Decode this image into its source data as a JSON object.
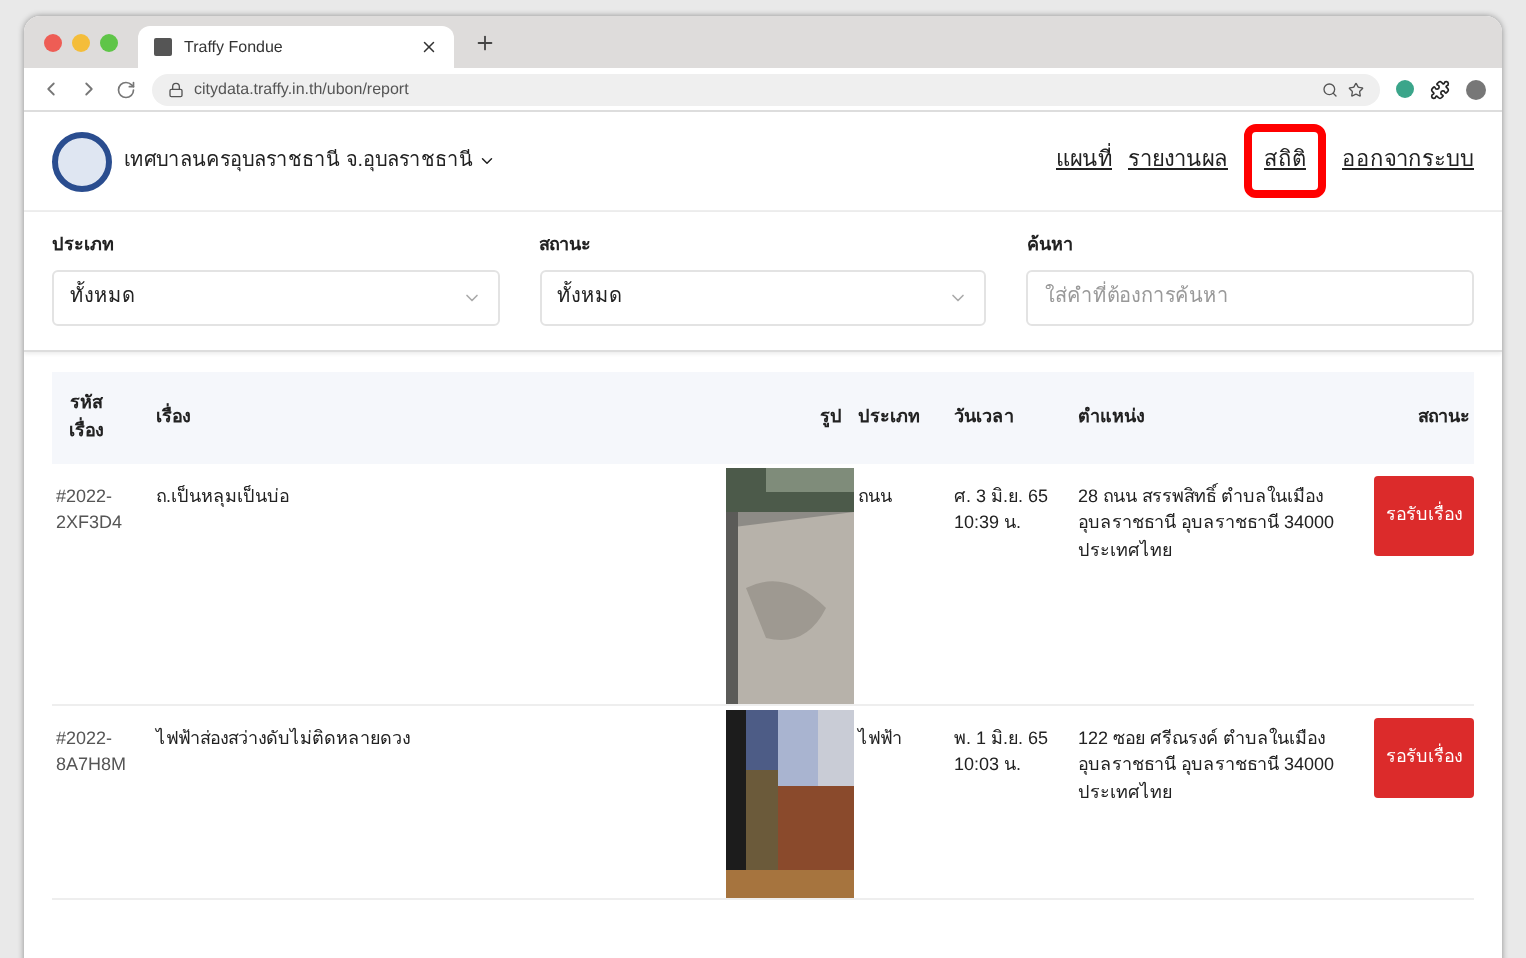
{
  "browser": {
    "tab_title": "Traffy Fondue",
    "url": "citydata.traffy.in.th/ubon/report"
  },
  "header": {
    "org": "เทศบาลนครอุบลราชธานี จ.อุบลราชธานี",
    "nav": [
      {
        "label": "แผนที่",
        "highlighted": false
      },
      {
        "label": "รายงานผล",
        "highlighted": false
      },
      {
        "label": "สถิติ",
        "highlighted": true
      },
      {
        "label": "ออกจากระบบ",
        "highlighted": false
      }
    ]
  },
  "filters": [
    {
      "kind": "select",
      "label": "ประเภท",
      "value": "ทั้งหมด"
    },
    {
      "kind": "select",
      "label": "สถานะ",
      "value": "ทั้งหมด"
    },
    {
      "kind": "search",
      "label": "ค้นหา",
      "placeholder": "ใส่คำที่ต้องการค้นหา"
    }
  ],
  "table": {
    "columns": [
      "รหัสเรื่อง",
      "เรื่อง",
      "รูป",
      "ประเภท",
      "วันเวลา",
      "ตำแหน่ง",
      "สถานะ"
    ],
    "rows": [
      {
        "id": "#2022-2XF3D4",
        "title": "ถ.เป็นหลุมเป็นบ่อ",
        "type": "ถนน",
        "time": "ศ. 3 มิ.ย. 65 10:39 น.",
        "location": "28 ถนน สรรพสิทธิ์ ตำบลในเมือง อุบลราชธานี อุบลราชธานี 34000 ประเทศไทย",
        "status": "รอรับเรื่อง"
      },
      {
        "id": "#2022-8A7H8M",
        "title": "ไฟฟ้าส่องสว่างดับไม่ติดหลายดวง",
        "type": "ไฟฟ้า",
        "time": "พ. 1 มิ.ย. 65 10:03 น.",
        "location": "122 ซอย ศรีณรงค์ ตำบลในเมือง อุบลราชธานี อุบลราชธานี 34000 ประเทศไทย",
        "status": "รอรับเรื่อง"
      }
    ]
  }
}
